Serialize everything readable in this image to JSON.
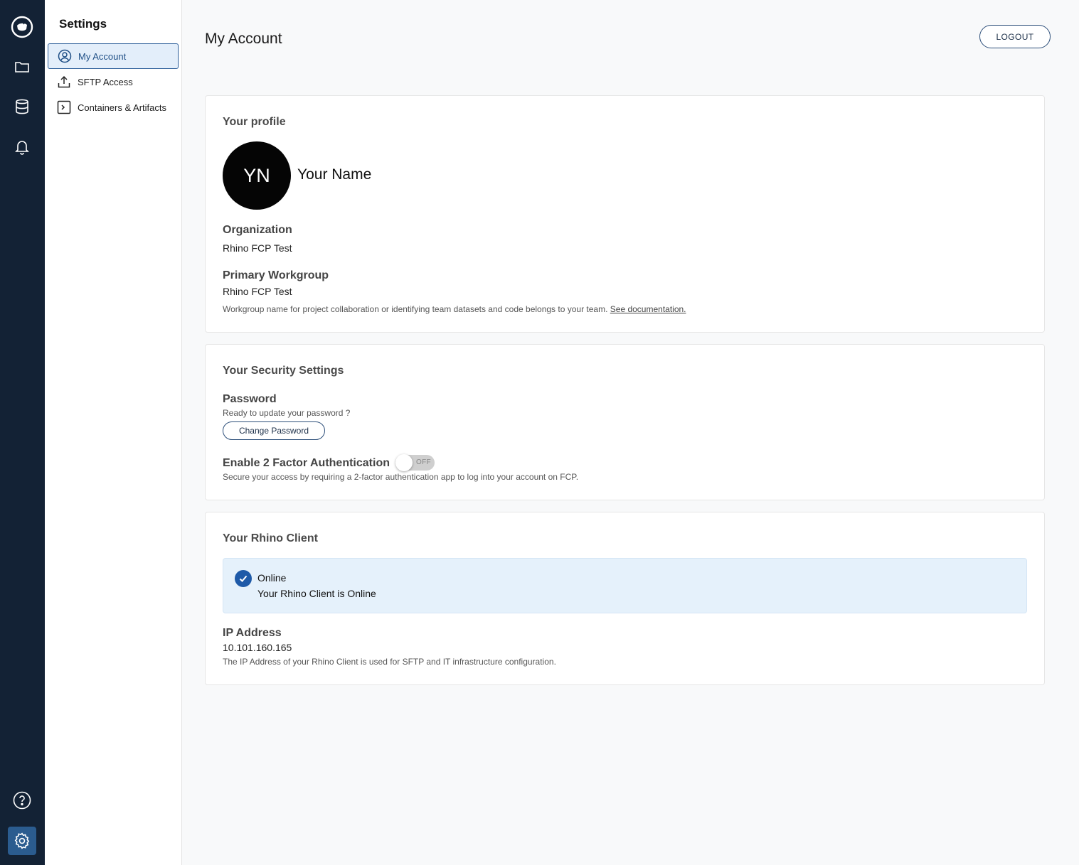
{
  "rail": {
    "icons": [
      "logo-icon",
      "folder-icon",
      "database-icon",
      "bell-icon",
      "help-icon",
      "settings-icon"
    ]
  },
  "settings_nav": {
    "title": "Settings",
    "items": [
      {
        "label": "My Account",
        "icon": "user-circle-icon",
        "active": true
      },
      {
        "label": "SFTP Access",
        "icon": "upload-icon",
        "active": false
      },
      {
        "label": "Containers & Artifacts",
        "icon": "terminal-icon",
        "active": false
      }
    ]
  },
  "header": {
    "title": "My Account",
    "logout_label": "LOGOUT"
  },
  "profile": {
    "section_title": "Your profile",
    "initials": "YN",
    "name": "Your Name",
    "organization_label": "Organization",
    "organization_value": "Rhino FCP Test",
    "workgroup_label": "Primary Workgroup",
    "workgroup_value": "Rhino FCP Test",
    "workgroup_help": "Workgroup name for project collaboration or identifying team datasets and code belongs to your team.",
    "workgroup_link": "See documentation."
  },
  "security": {
    "section_title": "Your Security Settings",
    "password_label": "Password",
    "password_help": "Ready to update your password ?",
    "change_password_label": "Change Password",
    "twofa_label": "Enable 2 Factor Authentication",
    "twofa_state": "OFF",
    "twofa_help": "Secure your access by requiring a 2-factor authentication app to log into your account on FCP."
  },
  "client": {
    "section_title": "Your Rhino Client",
    "status_title": "Online",
    "status_message": "Your Rhino Client is Online",
    "ip_label": "IP Address",
    "ip_value": "10.101.160.165",
    "ip_help": "The IP Address of your Rhino Client is used for SFTP and IT infrastructure configuration."
  },
  "colors": {
    "rail_bg": "#132235",
    "accent": "#2d5f9a",
    "status_bg": "#e5f1fb",
    "check": "#1e5aa8"
  }
}
